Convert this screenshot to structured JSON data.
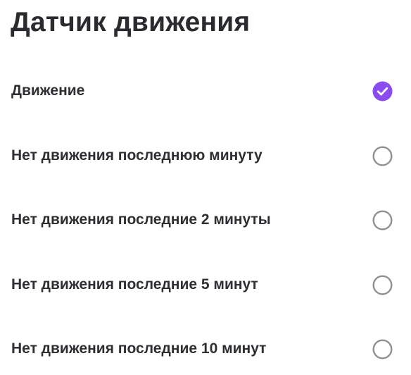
{
  "screen": {
    "title": "Датчик движения"
  },
  "options": [
    {
      "label": "Движение",
      "selected": true
    },
    {
      "label": "Нет движения последнюю минуту",
      "selected": false
    },
    {
      "label": "Нет движения последние 2 минуты",
      "selected": false
    },
    {
      "label": "Нет движения последние 5 минут",
      "selected": false
    },
    {
      "label": "Нет движения последние 10 минут",
      "selected": false
    }
  ],
  "colors": {
    "accent": "#8a4bf0",
    "radio_border": "#8f8f96",
    "text": "#2b2b2f"
  }
}
